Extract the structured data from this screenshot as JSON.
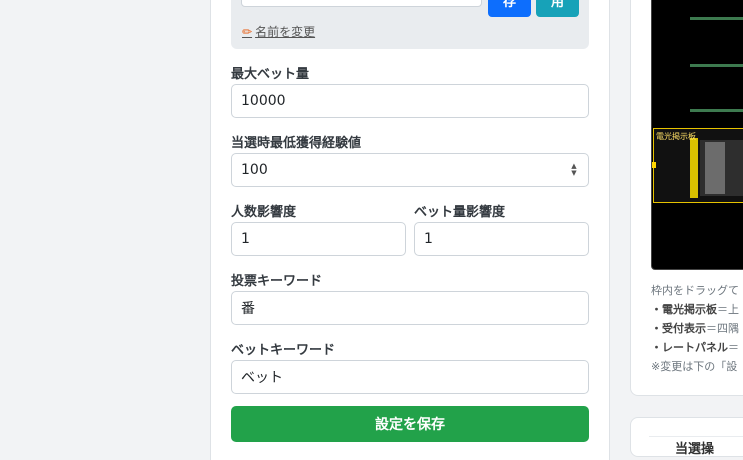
{
  "top": {
    "save_button": "存",
    "apply_button": "用",
    "rename_link": "名前を変更"
  },
  "fields": {
    "max_bet_label": "最大ベット量",
    "max_bet_value": "10000",
    "min_exp_label": "当選時最低獲得経験値",
    "min_exp_value": "100",
    "people_label": "人数影響度",
    "people_value": "1",
    "betamount_label": "ベット量影響度",
    "betamount_value": "1",
    "vote_kw_label": "投票キーワード",
    "vote_kw_value": "番",
    "bet_kw_label": "ベットキーワード",
    "bet_kw_value": "ベット"
  },
  "save_settings": "設定を保存",
  "preview": {
    "panel_label": "電光掲示板"
  },
  "help": {
    "line1": "枠内をドラッグて",
    "line2_name": "・電光掲示板",
    "line2_rest": "＝上",
    "line3_name": "・受付表示",
    "line3_rest": "＝四隅",
    "line4_name": "・レートパネル",
    "line4_rest": "＝",
    "line5": "※変更は下の「設"
  },
  "card2_title": "当選操"
}
